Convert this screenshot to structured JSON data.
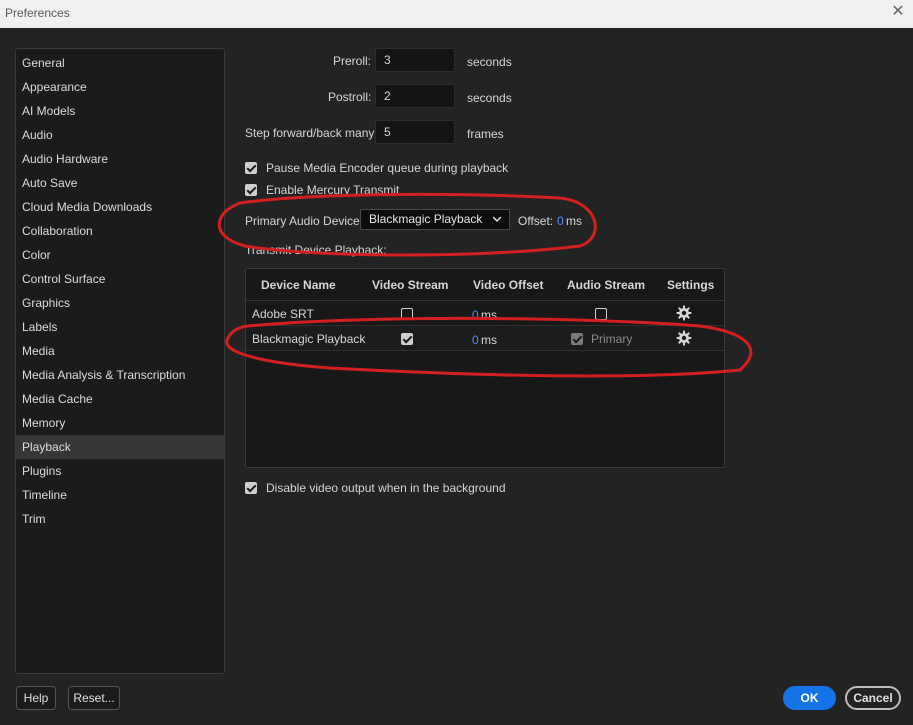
{
  "window": {
    "title": "Preferences",
    "close_glyph": "✕"
  },
  "sidebar": {
    "items": [
      {
        "label": "General"
      },
      {
        "label": "Appearance"
      },
      {
        "label": "AI Models"
      },
      {
        "label": "Audio"
      },
      {
        "label": "Audio Hardware"
      },
      {
        "label": "Auto Save"
      },
      {
        "label": "Cloud Media Downloads"
      },
      {
        "label": "Collaboration"
      },
      {
        "label": "Color"
      },
      {
        "label": "Control Surface"
      },
      {
        "label": "Graphics"
      },
      {
        "label": "Labels"
      },
      {
        "label": "Media"
      },
      {
        "label": "Media Analysis & Transcription"
      },
      {
        "label": "Media Cache"
      },
      {
        "label": "Memory"
      },
      {
        "label": "Playback",
        "selected": true
      },
      {
        "label": "Plugins"
      },
      {
        "label": "Timeline"
      },
      {
        "label": "Trim"
      }
    ]
  },
  "playback": {
    "preroll": {
      "label": "Preroll:",
      "value": "3",
      "unit": "seconds"
    },
    "postroll": {
      "label": "Postroll:",
      "value": "2",
      "unit": "seconds"
    },
    "step": {
      "label": "Step forward/back many:",
      "value": "5",
      "unit": "frames"
    },
    "pause_encoder": {
      "label": "Pause Media Encoder queue during playback",
      "checked": true
    },
    "mercury": {
      "label": "Enable Mercury Transmit",
      "checked": true
    },
    "primary_audio": {
      "label": "Primary Audio Device:",
      "value": "Blackmagic Playback",
      "offset_label": "Offset:",
      "offset_value": "0",
      "offset_unit": "ms"
    },
    "transmit_label": "Transmit Device Playback:",
    "table": {
      "headers": [
        "Device Name",
        "Video Stream",
        "Video Offset",
        "Audio Stream",
        "Settings"
      ],
      "rows": [
        {
          "name": "Adobe SRT",
          "video_stream": false,
          "video_offset": "0",
          "offset_unit": "ms",
          "audio_stream": false,
          "audio_label": ""
        },
        {
          "name": "Blackmagic Playback",
          "video_stream": true,
          "video_offset": "0",
          "offset_unit": "ms",
          "audio_stream": true,
          "audio_label": "Primary"
        }
      ]
    },
    "disable_bg": {
      "label": "Disable video output when in the background",
      "checked": true
    }
  },
  "footer": {
    "help": "Help",
    "reset": "Reset...",
    "ok": "OK",
    "cancel": "Cancel"
  },
  "colors": {
    "accent": "#1473e6",
    "value_blue": "#4e8ef7",
    "annotation_red": "#d21f1f"
  }
}
